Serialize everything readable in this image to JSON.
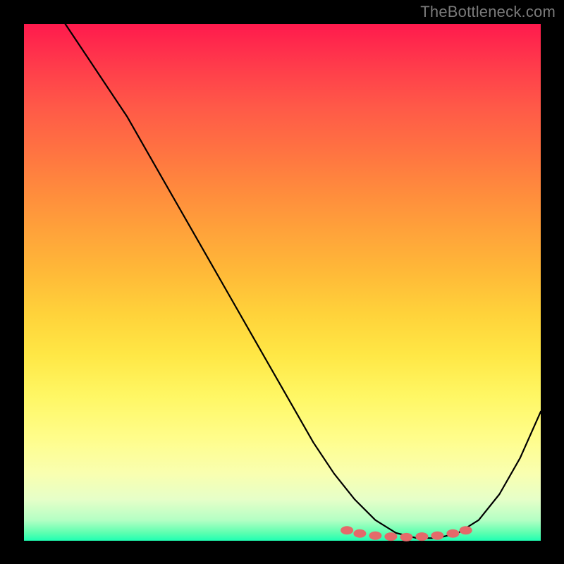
{
  "attribution": "TheBottleneck.com",
  "chart_data": {
    "type": "line",
    "title": "",
    "xlabel": "",
    "ylabel": "",
    "xlim": [
      0,
      100
    ],
    "ylim": [
      0,
      100
    ],
    "series": [
      {
        "name": "bottleneck-curve",
        "x": [
          8,
          12,
          16,
          20,
          24,
          28,
          32,
          36,
          40,
          44,
          48,
          52,
          56,
          60,
          64,
          68,
          72,
          76,
          80,
          84,
          88,
          92,
          96,
          100
        ],
        "values": [
          100,
          94,
          88,
          82,
          75,
          68,
          61,
          54,
          47,
          40,
          33,
          26,
          19,
          13,
          8,
          4,
          1.5,
          0.5,
          0.5,
          1.5,
          4,
          9,
          16,
          25
        ]
      }
    ],
    "markers": {
      "name": "optimal-zone-markers",
      "x": [
        62.5,
        65,
        68,
        71,
        74,
        77,
        80,
        83,
        85.5
      ],
      "values": [
        2.0,
        1.4,
        1.0,
        0.8,
        0.7,
        0.8,
        1.0,
        1.4,
        2.0
      ],
      "color": "#e46a6a"
    },
    "gradient_stops": [
      {
        "pos": 0,
        "color": "#ff1a4d"
      },
      {
        "pos": 50,
        "color": "#ffd23a"
      },
      {
        "pos": 85,
        "color": "#fffd8a"
      },
      {
        "pos": 100,
        "color": "#1fffb3"
      }
    ]
  }
}
